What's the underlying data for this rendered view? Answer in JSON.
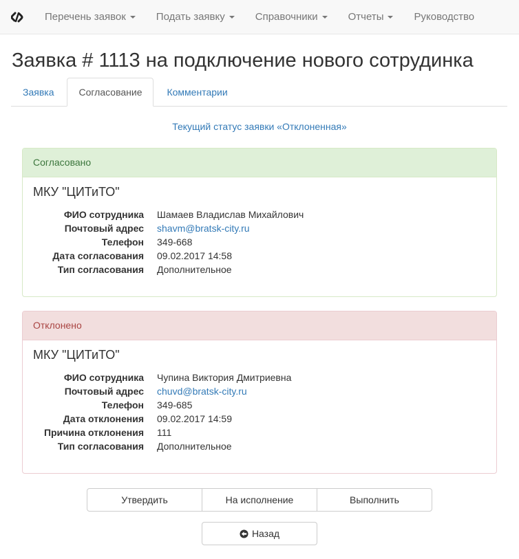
{
  "nav": {
    "items": [
      {
        "label": "Перечень заявок",
        "dropdown": true
      },
      {
        "label": "Подать заявку",
        "dropdown": true
      },
      {
        "label": "Справочники",
        "dropdown": true
      },
      {
        "label": "Отчеты",
        "dropdown": true
      },
      {
        "label": "Руководство",
        "dropdown": false
      }
    ]
  },
  "page": {
    "title": "Заявка # 1113 на подключение нового сотрудинка",
    "status": "Текущий статус заявки «Отклоненная»"
  },
  "tabs": [
    {
      "label": "Заявка",
      "active": false
    },
    {
      "label": "Согласование",
      "active": true
    },
    {
      "label": "Комментарии",
      "active": false
    }
  ],
  "approvals": [
    {
      "heading": "Согласовано",
      "org": "МКУ \"ЦИТиТО\"",
      "fields": [
        {
          "label": "ФИО сотрудника",
          "value": "Шамаев Владислав Михайлович"
        },
        {
          "label": "Почтовый адрес",
          "value": "shavm@bratsk-city.ru",
          "link": true
        },
        {
          "label": "Телефон",
          "value": "349-668"
        },
        {
          "label": "Дата согласования",
          "value": "09.02.2017 14:58"
        },
        {
          "label": "Тип согласования",
          "value": "Дополнительное"
        }
      ]
    },
    {
      "heading": "Отклонено",
      "org": "МКУ \"ЦИТиТО\"",
      "fields": [
        {
          "label": "ФИО сотрудника",
          "value": "Чупина Виктория Дмитриевна"
        },
        {
          "label": "Почтовый адрес",
          "value": "chuvd@bratsk-city.ru",
          "link": true
        },
        {
          "label": "Телефон",
          "value": "349-685"
        },
        {
          "label": "Дата отклонения",
          "value": "09.02.2017 14:59"
        },
        {
          "label": "Причина отклонения",
          "value": "111"
        },
        {
          "label": "Тип согласования",
          "value": "Дополнительное"
        }
      ]
    }
  ],
  "actions": {
    "approve": "Утвердить",
    "execute": "На исполнение",
    "complete": "Выполнить",
    "back": "Назад"
  }
}
